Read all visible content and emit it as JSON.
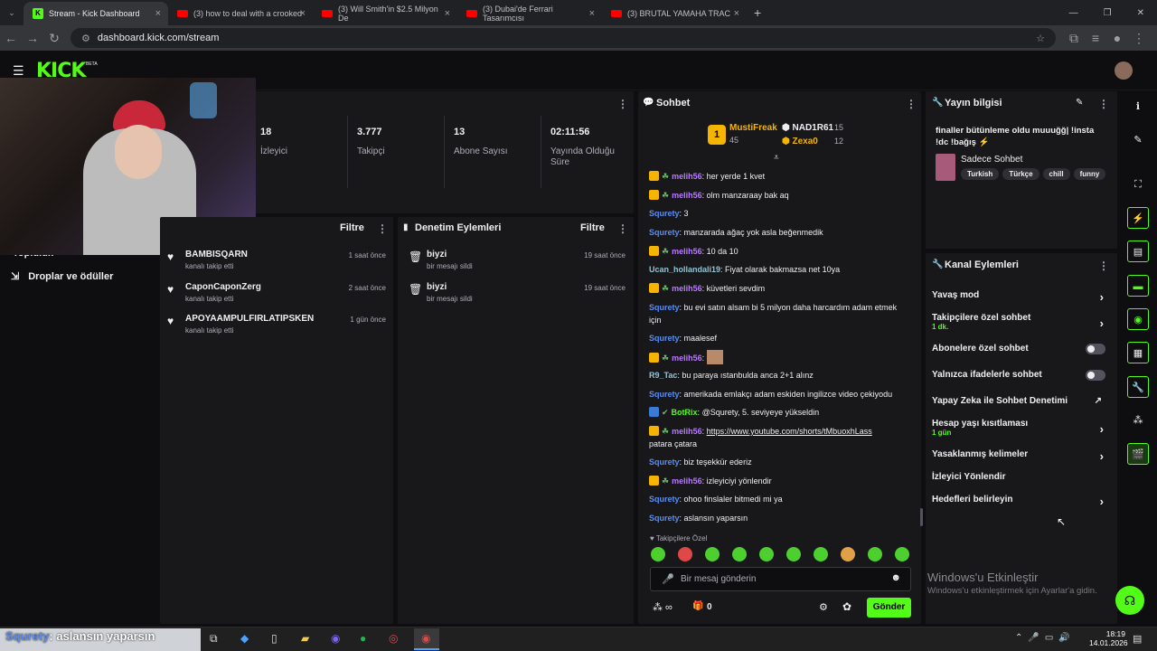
{
  "browser": {
    "tabs": [
      {
        "label": "Stream - Kick Dashboard",
        "icon": "kick-icon",
        "active": true
      },
      {
        "label": "(3) how to deal with a crooked",
        "icon": "youtube-icon"
      },
      {
        "label": "(3) Will Smith'in $2.5 Milyon De",
        "icon": "youtube-icon"
      },
      {
        "label": "(3) Dubai'de Ferrari Tasarımcısı",
        "icon": "youtube-icon"
      },
      {
        "label": "(3)  BRUTAL YAMAHA TRAC",
        "icon": "youtube-icon"
      }
    ],
    "new_tab": "+",
    "url": "dashboard.kick.com/stream"
  },
  "brand": {
    "logo": "KICK",
    "beta": "BETA",
    "accent": "#53fc18"
  },
  "stats": [
    {
      "value": "18",
      "label": "İzleyici"
    },
    {
      "value": "3.777",
      "label": "Takipçi"
    },
    {
      "value": "13",
      "label": "Abone Sayısı"
    },
    {
      "value": "02:11:56",
      "label": "Yayında Olduğu Süre"
    }
  ],
  "sidebar": {
    "partial": "Topluluk",
    "item": "Droplar ve ödüller"
  },
  "activity": {
    "filter": "Filtre",
    "rows": [
      {
        "name": "BAMBISQARN",
        "sub": "kanalı takip etti",
        "time": "1 saat önce"
      },
      {
        "name": "CaponCaponZerg",
        "sub": "kanalı takip etti",
        "time": "2 saat önce"
      },
      {
        "name": "APOYAAMPULFIRLATIPSKEN",
        "sub": "kanalı takip etti",
        "time": "1 gün önce"
      }
    ]
  },
  "moderation": {
    "title": "Denetim Eylemleri",
    "filter": "Filtre",
    "rows": [
      {
        "name": "biyzi",
        "sub": "bir mesajı sildi",
        "time": "19 saat önce"
      },
      {
        "name": "biyzi",
        "sub": "bir mesajı sildi",
        "time": "19 saat önce"
      }
    ]
  },
  "chat": {
    "title": "Sohbet",
    "top": [
      {
        "rank": "1",
        "name": "MustiFreak",
        "count": "45"
      },
      {
        "name": "NAD1R61",
        "count": "15"
      },
      {
        "name": "Zexa0",
        "count": "12"
      }
    ],
    "messages": [
      {
        "user": "melih56",
        "text": "her yerde 1 kvet"
      },
      {
        "user": "melih56",
        "text": "olm manzaraay bak aq"
      },
      {
        "user": "Squrety",
        "text": "3"
      },
      {
        "user": "Squrety",
        "text": "manzarada ağaç yok asla beğenmedik"
      },
      {
        "user": "melih56",
        "text": "10 da 10"
      },
      {
        "user": "Ucan_hollandali19",
        "text": "Fiyat olarak bakmazsa net 10ya"
      },
      {
        "user": "melih56",
        "text": "küvetleri sevdim"
      },
      {
        "user": "Squrety",
        "text": "bu evi satın alsam bi 5 milyon daha harcardım adam etmek için"
      },
      {
        "user": "Squrety",
        "text": "maalesef"
      },
      {
        "user": "melih56",
        "text": ""
      },
      {
        "user": "R9_Tac",
        "text": "bu paraya ıstanbulda anca 2+1 alınz"
      },
      {
        "user": "Squrety",
        "text": "amerikada emlakçı adam eskiden ingilizce video çekiyodu"
      },
      {
        "user": "BotRix",
        "text": "@Squrety, 5. seviyeye yükseldin"
      },
      {
        "user": "melih56",
        "text": "https://www.youtube.com/shorts/tMbuoxhLass",
        "text2": "patara çatara"
      },
      {
        "user": "Squrety",
        "text": "biz teşekkür ederiz"
      },
      {
        "user": "melih56",
        "text": "izleyiciyi yönlendir"
      },
      {
        "user": "Squrety",
        "text": "ohoo finslaler bitmedi mi ya"
      },
      {
        "user": "Squrety",
        "text": "aslansın yaparsın"
      }
    ],
    "emote_label": "Takipçilere Özel",
    "input_placeholder": "Bir mesaj gönderin",
    "points": "0",
    "send": "Gönder"
  },
  "stream_info": {
    "title": "Yayın bilgisi",
    "stream_title": "finaller bütünleme oldu muuuğğ| !insta !dc !bağış ⚡",
    "category": "Sadece Sohbet",
    "tags": [
      "Turkish",
      "Türkçe",
      "chill",
      "funny"
    ]
  },
  "channel_actions": {
    "title": "Kanal Eylemleri",
    "items": [
      {
        "label": "Yavaş mod",
        "control": "chevron"
      },
      {
        "label": "Takipçilere özel sohbet",
        "sub": "1 dk.",
        "control": "chevron"
      },
      {
        "label": "Abonelere özel sohbet",
        "control": "toggle"
      },
      {
        "label": "Yalnızca ifadelerle sohbet",
        "control": "toggle"
      },
      {
        "label": "Yapay Zeka ile Sohbet Denetimi",
        "control": "external"
      },
      {
        "label": "Hesap yaşı kısıtlaması",
        "sub": "1 gün",
        "control": "chevron"
      },
      {
        "label": "Yasaklanmış kelimeler",
        "control": "chevron"
      },
      {
        "label": "İzleyici Yönlendir",
        "control": "none"
      },
      {
        "label": "Hedefleri belirleyin",
        "control": "chevron"
      }
    ]
  },
  "watermark": {
    "title": "Windows'u Etkinleştir",
    "sub": "Windows'u etkinleştirmek için Ayarlar'a gidin."
  },
  "overlay": {
    "user": "Squrety",
    "text": ": aslansın yaparsın"
  },
  "taskbar": {
    "time": "18:19",
    "date": "14.01.2026"
  }
}
